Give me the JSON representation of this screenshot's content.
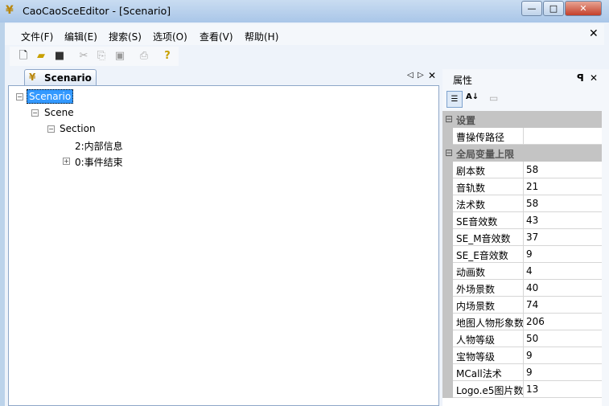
{
  "window": {
    "title": "CaoCaoSceEditor - [Scenario]"
  },
  "menu": [
    "文件(F)",
    "编辑(E)",
    "搜索(S)",
    "选项(O)",
    "查看(V)",
    "帮助(H)"
  ],
  "doc_tab": "Scenario",
  "tree": {
    "root": "Scenario",
    "scene": "Scene",
    "section": "Section",
    "children": [
      "2:内部信息",
      "0:事件结束"
    ]
  },
  "properties": {
    "title": "属性",
    "categories": [
      {
        "name": "设置",
        "items": [
          {
            "name": "曹操传路径",
            "value": ""
          }
        ]
      },
      {
        "name": "全局变量上限",
        "items": [
          {
            "name": "剧本数",
            "value": "58"
          },
          {
            "name": "音轨数",
            "value": "21"
          },
          {
            "name": "法术数",
            "value": "58"
          },
          {
            "name": "SE音效数",
            "value": "43"
          },
          {
            "name": "SE_M音效数",
            "value": "37"
          },
          {
            "name": "SE_E音效数",
            "value": "9"
          },
          {
            "name": "动画数",
            "value": "4"
          },
          {
            "name": "外场景数",
            "value": "40"
          },
          {
            "name": "内场景数",
            "value": "74"
          },
          {
            "name": "地图人物形象数",
            "value": "206"
          },
          {
            "name": "人物等级",
            "value": "50"
          },
          {
            "name": "宝物等级",
            "value": "9"
          },
          {
            "name": "MCall法术",
            "value": "9"
          },
          {
            "name": "Logo.e5图片数",
            "value": "13"
          }
        ]
      }
    ]
  }
}
